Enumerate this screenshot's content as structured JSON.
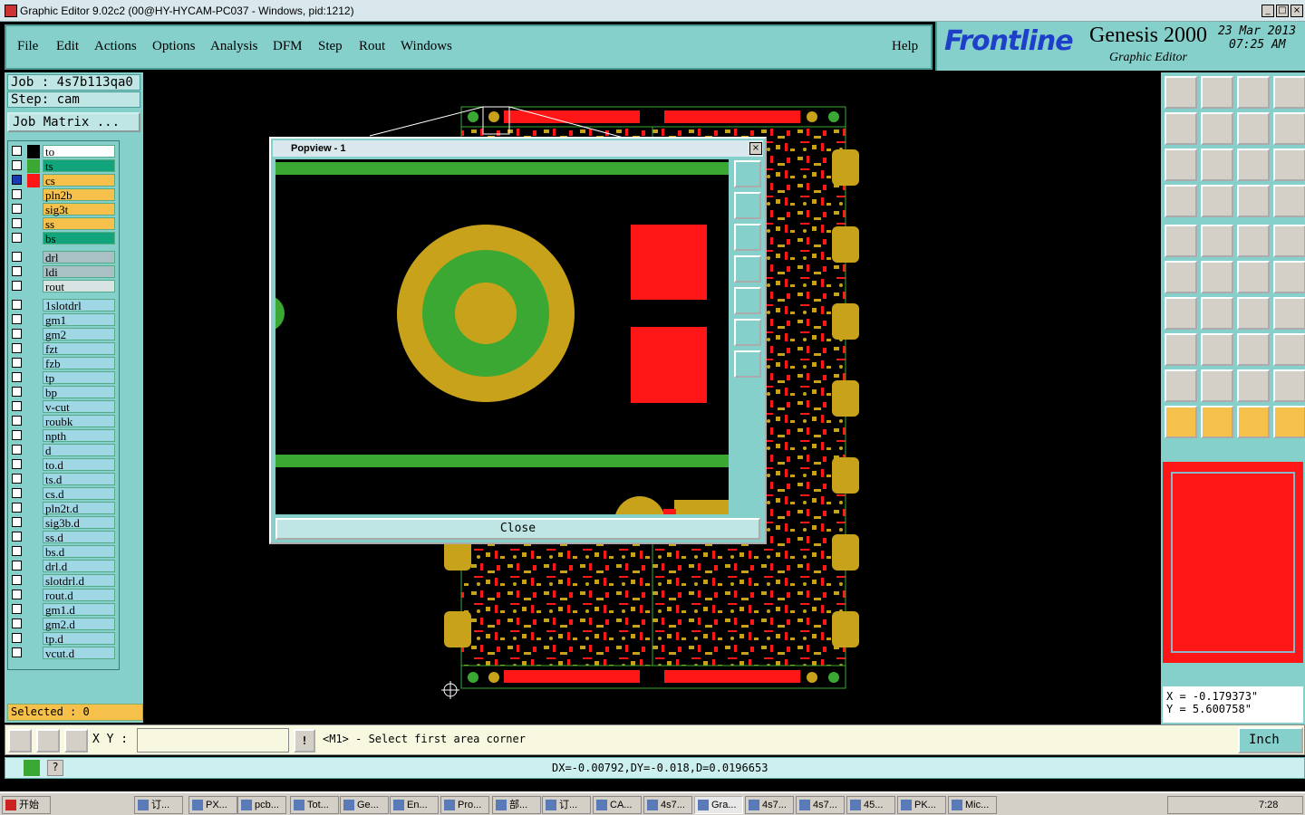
{
  "window": {
    "title": "Graphic Editor 9.02c2 (00@HY-HYCAM-PC037 - Windows, pid:1212)"
  },
  "menu": {
    "items": [
      "File",
      "Edit",
      "Actions",
      "Options",
      "Analysis",
      "DFM",
      "Step",
      "Rout",
      "Windows"
    ],
    "help": "Help"
  },
  "brand": {
    "logo": "Frontline",
    "product": "Genesis 2000",
    "subtitle": "Graphic Editor",
    "date": "23 Mar 2013",
    "time": "07:25 AM"
  },
  "job": {
    "job_label": "Job : 4s7b113qa0",
    "step_label": "Step: cam",
    "matrix": "Job Matrix ..."
  },
  "layers": [
    {
      "name": "to",
      "color": "#ffffff",
      "swatch": "#000000"
    },
    {
      "name": "ts",
      "color": "#12a47a",
      "swatch": "#3aa832"
    },
    {
      "name": "cs",
      "color": "#f6c14a",
      "swatch": "#ff1616",
      "active": true
    },
    {
      "name": "pln2b",
      "color": "#f6c14a",
      "swatch": ""
    },
    {
      "name": "sig3t",
      "color": "#f6c14a",
      "swatch": ""
    },
    {
      "name": "ss",
      "color": "#f6c14a",
      "swatch": ""
    },
    {
      "name": "bs",
      "color": "#12a47a",
      "swatch": ""
    },
    {
      "name": "drl",
      "color": "#a9c1c5",
      "swatch": ""
    },
    {
      "name": "ldi",
      "color": "#a9c1c5",
      "swatch": ""
    },
    {
      "name": "rout",
      "color": "#d8e4e4",
      "swatch": ""
    },
    {
      "name": "1slotdrl",
      "color": "#9fd8e4",
      "swatch": ""
    },
    {
      "name": "gm1",
      "color": "#9fd8e4",
      "swatch": ""
    },
    {
      "name": "gm2",
      "color": "#9fd8e4",
      "swatch": ""
    },
    {
      "name": "fzt",
      "color": "#9fd8e4",
      "swatch": ""
    },
    {
      "name": "fzb",
      "color": "#9fd8e4",
      "swatch": ""
    },
    {
      "name": "tp",
      "color": "#9fd8e4",
      "swatch": ""
    },
    {
      "name": "bp",
      "color": "#9fd8e4",
      "swatch": ""
    },
    {
      "name": "v-cut",
      "color": "#9fd8e4",
      "swatch": ""
    },
    {
      "name": "roubk",
      "color": "#9fd8e4",
      "swatch": ""
    },
    {
      "name": "npth",
      "color": "#9fd8e4",
      "swatch": ""
    },
    {
      "name": "d",
      "color": "#9fd8e4",
      "swatch": ""
    },
    {
      "name": "to.d",
      "color": "#9fd8e4",
      "swatch": ""
    },
    {
      "name": "ts.d",
      "color": "#9fd8e4",
      "swatch": ""
    },
    {
      "name": "cs.d",
      "color": "#9fd8e4",
      "swatch": ""
    },
    {
      "name": "pln2t.d",
      "color": "#9fd8e4",
      "swatch": ""
    },
    {
      "name": "sig3b.d",
      "color": "#9fd8e4",
      "swatch": ""
    },
    {
      "name": "ss.d",
      "color": "#9fd8e4",
      "swatch": ""
    },
    {
      "name": "bs.d",
      "color": "#9fd8e4",
      "swatch": ""
    },
    {
      "name": "drl.d",
      "color": "#9fd8e4",
      "swatch": ""
    },
    {
      "name": "slotdrl.d",
      "color": "#9fd8e4",
      "swatch": ""
    },
    {
      "name": "rout.d",
      "color": "#9fd8e4",
      "swatch": ""
    },
    {
      "name": "gm1.d",
      "color": "#9fd8e4",
      "swatch": ""
    },
    {
      "name": "gm2.d",
      "color": "#9fd8e4",
      "swatch": ""
    },
    {
      "name": "tp.d",
      "color": "#9fd8e4",
      "swatch": ""
    },
    {
      "name": "vcut.d",
      "color": "#9fd8e4",
      "swatch": ""
    }
  ],
  "selected": "Selected : 0",
  "popview": {
    "title": "Popview - 1",
    "close": "Close"
  },
  "coords": {
    "x": "X = -0.179373\"",
    "y": "Y = 5.600758\""
  },
  "command": {
    "xy_label": "X Y :",
    "xy_value": "",
    "prompt": "<M1> - Select first area corner",
    "units": "Inch"
  },
  "status": {
    "delta": "DX=-0.00792,DY=-0.018,D=0.0196653"
  },
  "taskbar": {
    "start": "开始",
    "tasks": [
      "订...",
      "PX...",
      "pcb...",
      "Tot...",
      "Ge...",
      "En...",
      "Pro...",
      "部...",
      "订...",
      "CA...",
      "4s7...",
      "Gra...",
      "4s7...",
      "4s7...",
      "45...",
      "PK...",
      "Mic..."
    ],
    "clock": "7:28"
  },
  "colors": {
    "panel": "#86d0cc",
    "copper": "#ff1616",
    "gold": "#c8a21a",
    "green": "#3aa832"
  }
}
